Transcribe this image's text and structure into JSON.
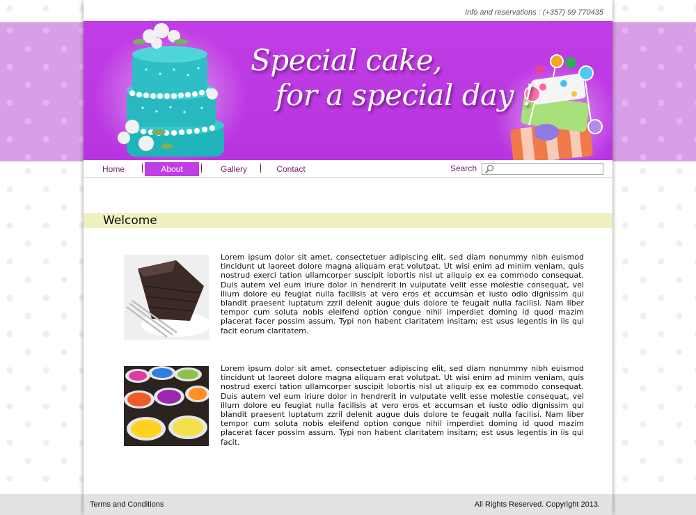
{
  "header": {
    "contact_line": "Info and reservations : (+357) 99 770435",
    "tagline_line1": "Special cake,",
    "tagline_line2": "for a special day !"
  },
  "nav": {
    "items": [
      {
        "label": "Home",
        "active": false
      },
      {
        "label": "About",
        "active": true
      },
      {
        "label": "Gallery",
        "active": false
      },
      {
        "label": "Contact",
        "active": false
      }
    ],
    "search_label": "Search",
    "search_value": ""
  },
  "main": {
    "heading": "Welcome",
    "sections": [
      {
        "image": "chocolate-cake-slice",
        "text": "Lorem ipsum dolor sit amet, consectetuer adipiscing elit, sed diam nonummy nibh euismod tincidunt ut laoreet dolore magna aliquam erat volutpat. Ut wisi enim ad minim veniam, quis nostrud exerci tation ullamcorper suscipit lobortis nisl ut aliquip ex ea commodo consequat. Duis autem vel eum iriure dolor in hendrerit in vulputate velit esse molestie consequat, vel illum dolore eu feugiat nulla facilisis at vero eros et accumsan et iusto odio dignissim qui blandit praesent luptatum zzril delenit augue duis dolore te feugait nulla facilisi. Nam liber tempor cum soluta nobis eleifend option congue nihil imperdiet doming id quod mazim placerat facer possim assum. Typi non habent claritatem insitam; est usus legentis in iis qui facit eorum claritatem."
      },
      {
        "image": "icing-color-bowls",
        "text": "Lorem ipsum dolor sit amet, consectetuer adipiscing elit, sed diam nonummy nibh euismod tincidunt ut laoreet dolore magna aliquam erat volutpat. Ut wisi enim ad minim veniam, quis nostrud exerci tation ullamcorper suscipit lobortis nisl ut aliquip ex ea commodo consequat. Duis autem vel eum iriure dolor in hendrerit in vulputate velit esse molestie consequat, vel illum dolore eu feugiat nulla facilisis at vero eros et accumsan et iusto odio dignissim qui blandit praesent luptatum zzril delenit augue duis dolore te feugait nulla facilisi. Nam liber tempor cum soluta nobis eleifend option congue nihil imperdiet doming id quod mazim placerat facer possim assum. Typi non habent claritatem insitam; est usus legentis in iis qui facit."
      }
    ]
  },
  "footer": {
    "terms_label": "Terms and Conditions",
    "copyright": "All Rights Reserved. Copyright 2013."
  },
  "colors": {
    "accent": "#c13ee6",
    "nav_text": "#7a1d6e",
    "welcome_bar": "#f1f0c0",
    "footer": "#e2e2e2"
  }
}
